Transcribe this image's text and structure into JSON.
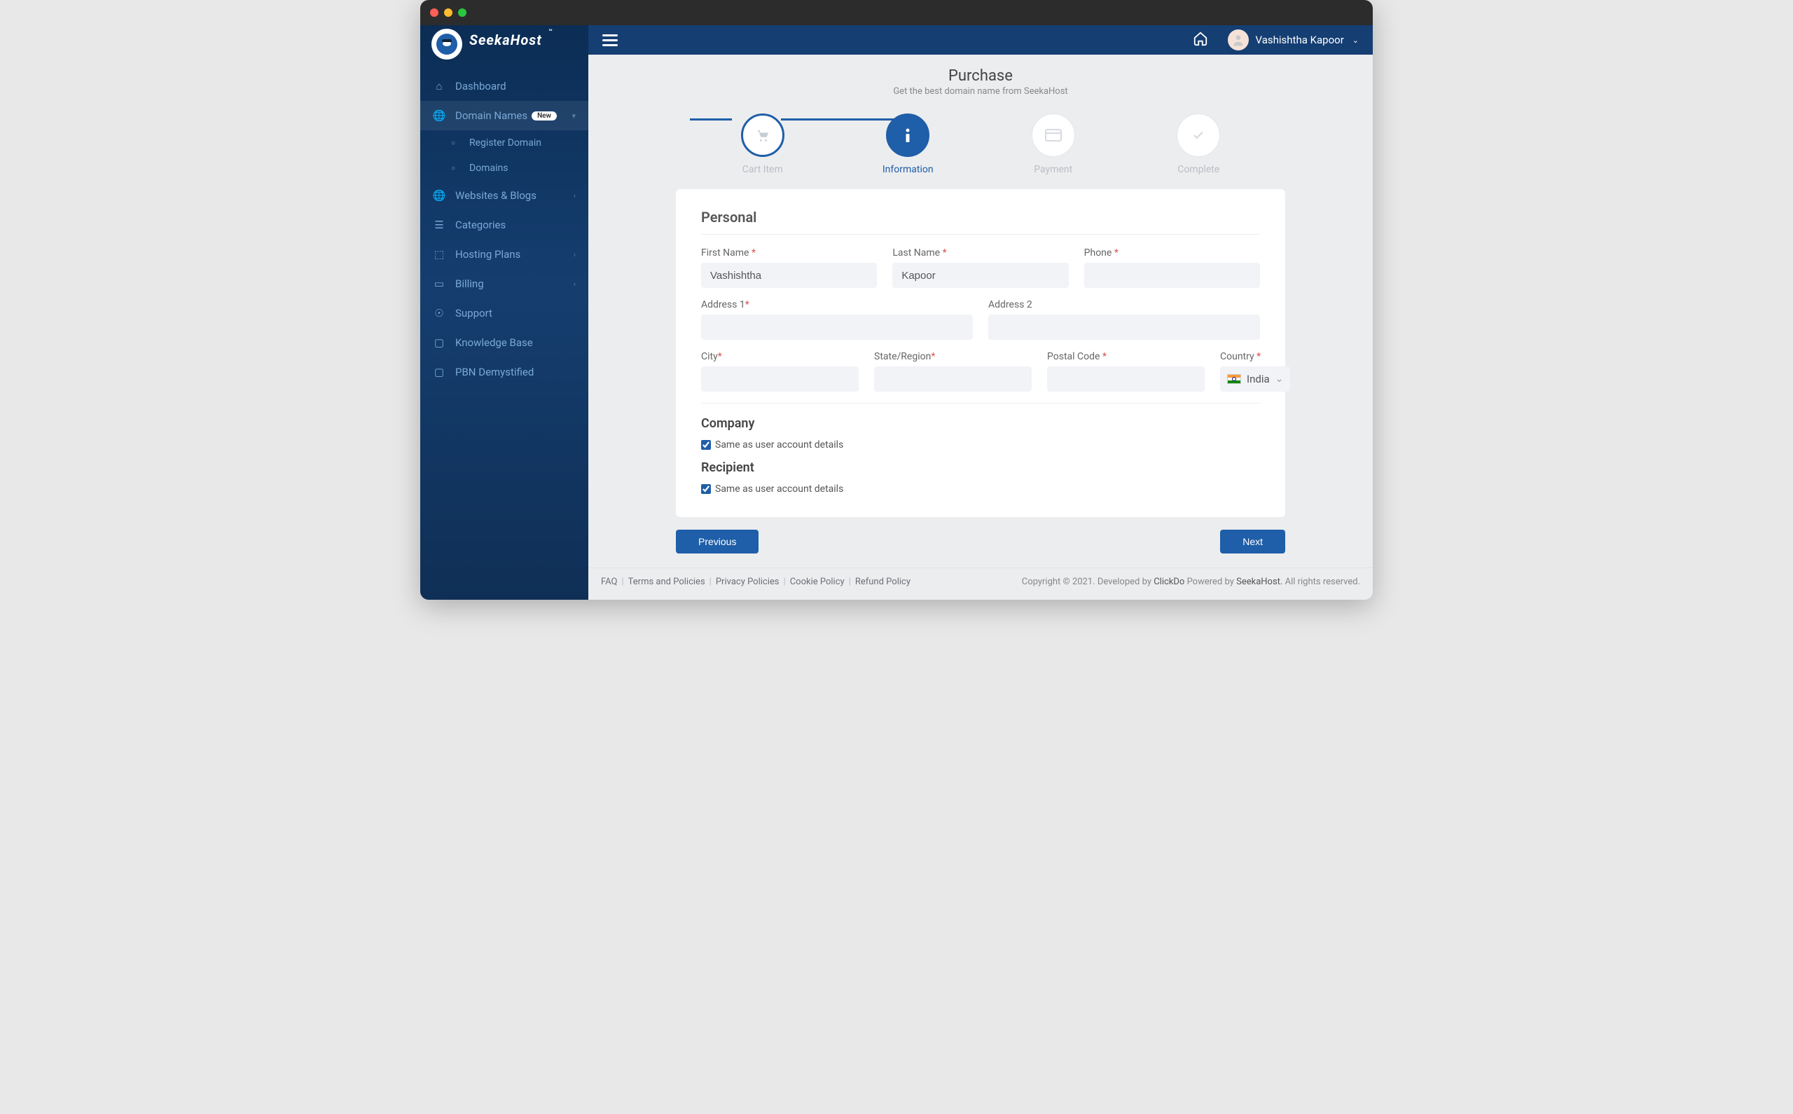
{
  "brand": {
    "name": "SeekaHost",
    "tm": "™"
  },
  "topbar": {
    "username": "Vashishtha Kapoor"
  },
  "sidebar": {
    "dashboard": "Dashboard",
    "domain_names": "Domain Names",
    "domain_badge": "New",
    "register_domain": "Register Domain",
    "domains": "Domains",
    "websites": "Websites & Blogs",
    "categories": "Categories",
    "hosting": "Hosting Plans",
    "billing": "Billing",
    "support": "Support",
    "knowledge": "Knowledge Base",
    "pbn": "PBN Demystified"
  },
  "page": {
    "title": "Purchase",
    "subtitle": "Get the best domain name from SeekaHost"
  },
  "stepper": {
    "cart": "Cart Item",
    "info": "Information",
    "payment": "Payment",
    "complete": "Complete"
  },
  "form": {
    "personal_title": "Personal",
    "first_name_label": "First Name",
    "first_name_value": "Vashishtha",
    "last_name_label": "Last Name",
    "last_name_value": "Kapoor",
    "phone_label": "Phone",
    "phone_value": "",
    "address1_label": "Address 1",
    "address1_value": "",
    "address2_label": "Address 2",
    "address2_value": "",
    "city_label": "City",
    "city_value": "",
    "state_label": "State/Region",
    "state_value": "",
    "postal_label": "Postal Code",
    "postal_value": "",
    "country_label": "Country",
    "country_value": "India",
    "company_title": "Company",
    "recipient_title": "Recipient",
    "same_as": "Same as user account details"
  },
  "buttons": {
    "prev": "Previous",
    "next": "Next"
  },
  "footer": {
    "faq": "FAQ",
    "terms": "Terms and Policies",
    "privacy": "Privacy Policies",
    "cookie": "Cookie Policy",
    "refund": "Refund Policy",
    "copyright_prefix": "Copyright © 2021. Developed by ",
    "clickdo": "ClickDo",
    "powered_mid": " Powered by ",
    "seekahost": "SeekaHost.",
    "rights": " All rights reserved."
  }
}
